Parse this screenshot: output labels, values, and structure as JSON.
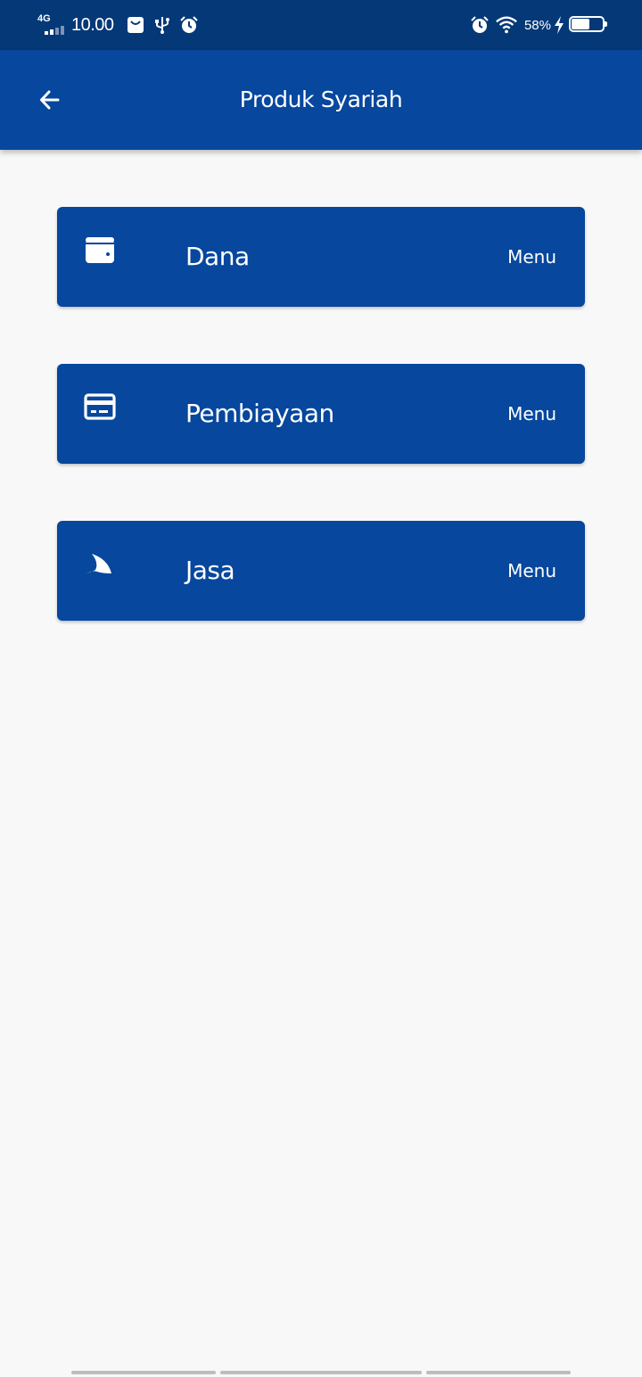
{
  "status_bar": {
    "network_type": "4G",
    "time": "10.00",
    "battery_percent_text": "58%",
    "battery_level": 0.58,
    "left_icons": [
      "shopping-bag-icon",
      "usb-icon",
      "alarm-icon"
    ],
    "right_icons": [
      "alarm-icon",
      "wifi-icon",
      "charging-bolt-icon",
      "battery-icon"
    ]
  },
  "app_bar": {
    "title": "Produk Syariah",
    "back_icon": "arrow-left-icon",
    "background_color": "#07479d"
  },
  "menu": {
    "items": [
      {
        "label": "Dana",
        "action_label": "Menu",
        "icon": "wallet-icon"
      },
      {
        "label": "Pembiayaan",
        "action_label": "Menu",
        "icon": "credit-card-icon"
      },
      {
        "label": "Jasa",
        "action_label": "Menu",
        "icon": "shark-fin-icon"
      }
    ]
  },
  "colors": {
    "primary": "#07479d",
    "status_bar": "#053877",
    "background": "#f8f8f8",
    "on_primary": "#ffffff"
  }
}
